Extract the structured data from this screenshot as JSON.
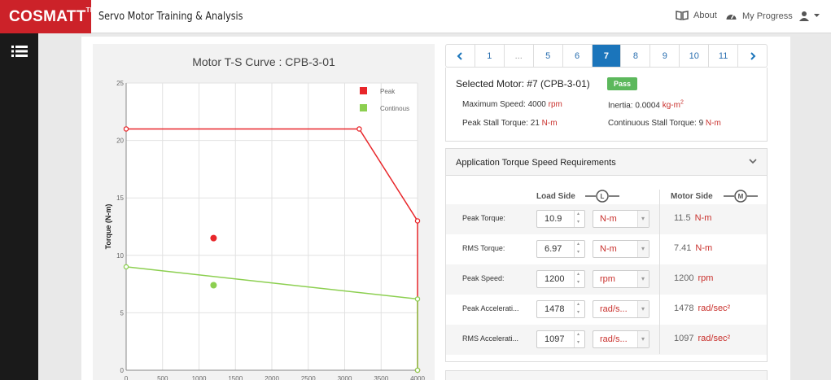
{
  "app": {
    "logo": "COSMATT",
    "logo_tm": "TM",
    "title": "Servo Motor Training & Analysis",
    "about": "About",
    "progress": "My Progress"
  },
  "chart_data": {
    "type": "line",
    "title": "Motor T-S Curve : CPB-3-01",
    "ylabel": "Torque (N-m)",
    "xlabel": "",
    "xlim": [
      0,
      4000
    ],
    "ylim": [
      0,
      25
    ],
    "x_ticks": [
      "0",
      "500",
      "1000",
      "1500",
      "2000",
      "2500",
      "3000",
      "3500",
      "4000"
    ],
    "y_ticks": [
      "0",
      "5",
      "10",
      "15",
      "20",
      "25"
    ],
    "grid": true,
    "legend_position": "top-right",
    "series": [
      {
        "name": "Peak",
        "color": "#e8262a",
        "points": [
          [
            0,
            21
          ],
          [
            3200,
            21
          ],
          [
            4000,
            13
          ],
          [
            4000,
            0
          ]
        ]
      },
      {
        "name": "Continous",
        "color": "#8ccf50",
        "points": [
          [
            0,
            9
          ],
          [
            4000,
            6.2
          ],
          [
            4000,
            0
          ]
        ]
      }
    ],
    "markers": [
      {
        "series": "Peak",
        "x": 1200,
        "y": 11.5,
        "color": "#e8262a"
      },
      {
        "series": "Continous",
        "x": 1200,
        "y": 7.4,
        "color": "#8ccf50"
      }
    ]
  },
  "pager": {
    "prev_icon": "chevron-left-icon",
    "next_icon": "chevron-right-icon",
    "pages": [
      "1",
      "...",
      "5",
      "6",
      "7",
      "8",
      "9",
      "10",
      "11"
    ],
    "active": "7"
  },
  "motor": {
    "selected": "Selected Motor: #7 (CPB-3-01)",
    "status": "Pass",
    "max_speed_label": "Maximum Speed:",
    "max_speed": "4000",
    "max_speed_unit": "rpm",
    "inertia_label": "Inertia:",
    "inertia": "0.0004",
    "inertia_unit": "kg-m",
    "inertia_exp": "2",
    "stall_label": "Peak Stall Torque:",
    "stall": "21",
    "stall_unit": "N-m",
    "cont_label": "Continuous Stall Torque:",
    "cont": "9",
    "cont_unit": "N-m"
  },
  "requirements": {
    "title": "Application Torque Speed Requirements",
    "load_side": "Load Side",
    "motor_side": "Motor Side",
    "rows": [
      {
        "label": "Peak Torque:",
        "value": "10.9",
        "unit": "N-m",
        "motor_value": "11.5",
        "motor_unit": "N-m"
      },
      {
        "label": "RMS Torque:",
        "value": "6.97",
        "unit": "N-m",
        "motor_value": "7.41",
        "motor_unit": "N-m"
      },
      {
        "label": "Peak Speed:",
        "value": "1200",
        "unit": "rpm",
        "motor_value": "1200",
        "motor_unit": "rpm"
      },
      {
        "label": "Peak Accelerati...",
        "value": "1478",
        "unit": "rad/s...",
        "motor_value": "1478",
        "motor_unit": "rad/sec²"
      },
      {
        "label": "RMS Accelerati...",
        "value": "1097",
        "unit": "rad/s...",
        "motor_value": "1097",
        "motor_unit": "rad/sec²"
      }
    ]
  }
}
